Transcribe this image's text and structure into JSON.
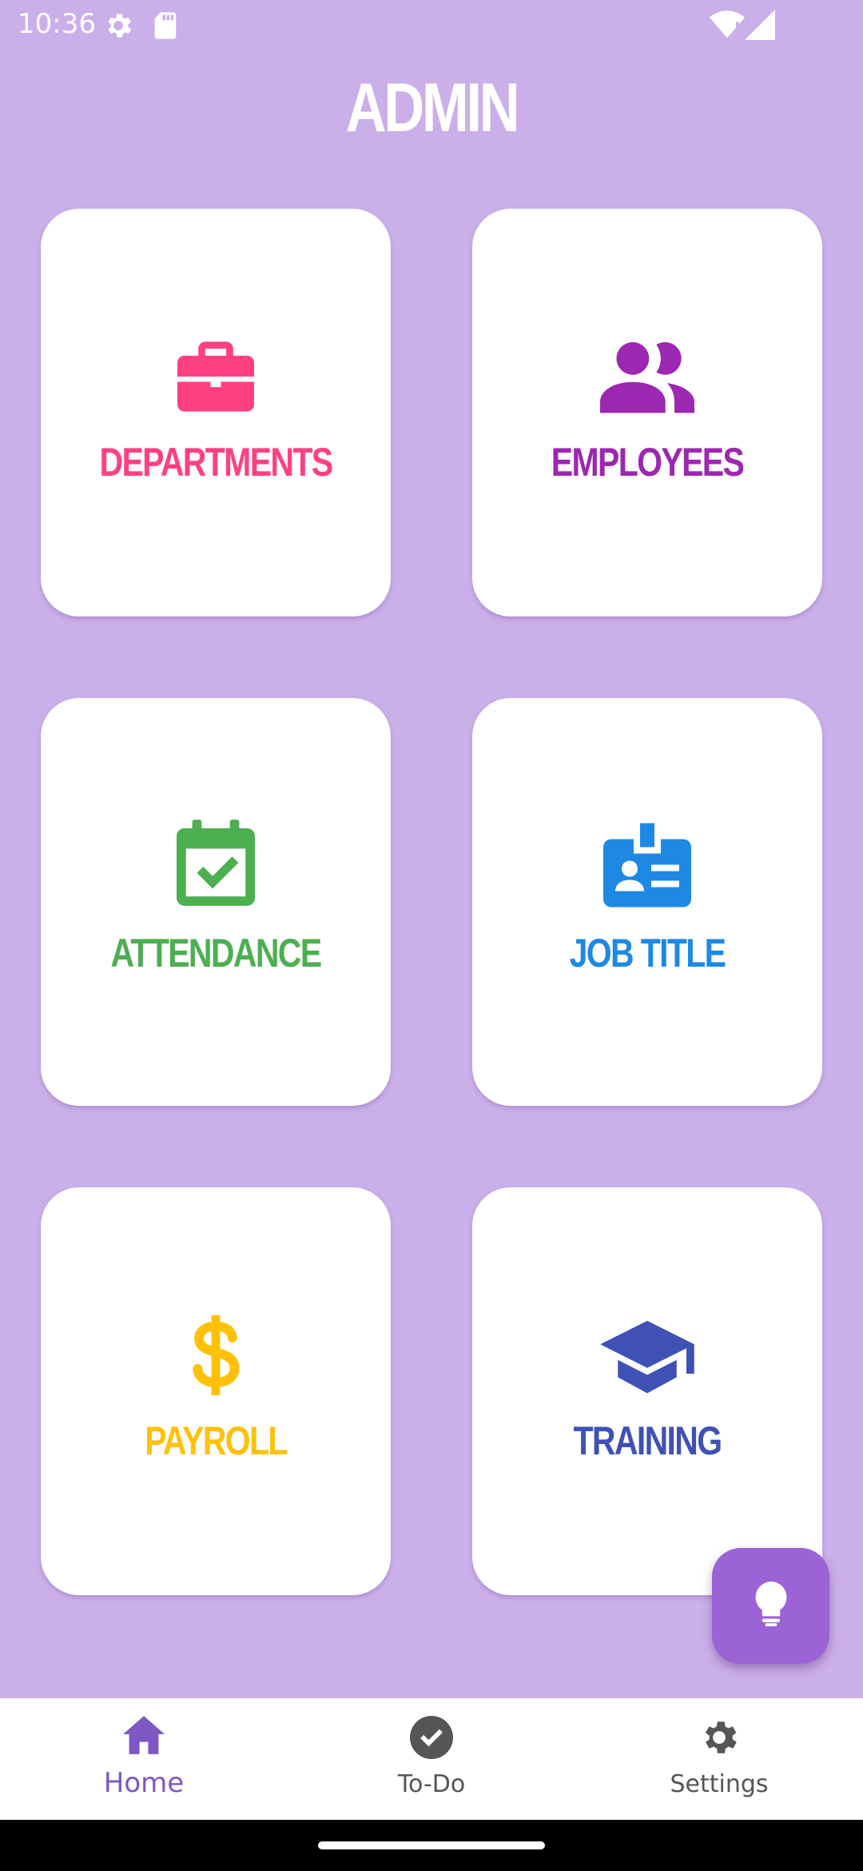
{
  "status_bar": {
    "time": "10:36",
    "icons": [
      "gear-icon",
      "sd-card-icon",
      "wifi-icon",
      "signal-icon"
    ]
  },
  "header": {
    "title": "ADMIN"
  },
  "cards": [
    {
      "label": "DEPARTMENTS",
      "icon": "briefcase-icon",
      "color": "#ff4081"
    },
    {
      "label": "EMPLOYEES",
      "icon": "people-icon",
      "color": "#9c27b0"
    },
    {
      "label": "ATTENDANCE",
      "icon": "calendar-check-icon",
      "color": "#4caf50"
    },
    {
      "label": "JOB TITLE",
      "icon": "badge-icon",
      "color": "#1e88e5"
    },
    {
      "label": "PAYROLL",
      "icon": "dollar-icon",
      "color": "#ffc107"
    },
    {
      "label": "TRAINING",
      "icon": "graduation-cap-icon",
      "color": "#3f51b5"
    }
  ],
  "fab": {
    "icon": "lightbulb-icon",
    "color": "#9b63d6"
  },
  "bottom_nav": {
    "items": [
      {
        "label": "Home",
        "icon": "home-icon",
        "active": true
      },
      {
        "label": "To-Do",
        "icon": "check-circle-icon",
        "active": false
      },
      {
        "label": "Settings",
        "icon": "settings-gear-icon",
        "active": false
      }
    ],
    "active_color": "#7e57c2"
  },
  "colors": {
    "background": "#cbafe9",
    "card": "#ffffff"
  }
}
